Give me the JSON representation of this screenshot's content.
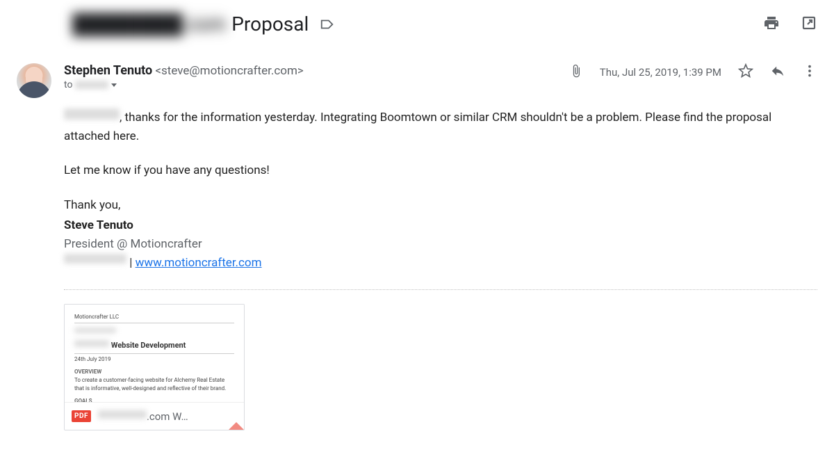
{
  "subject": {
    "redacted_prefix": "████████.com",
    "text": "Proposal"
  },
  "sender": {
    "name": "Stephen Tenuto",
    "email": "<steve@motioncrafter.com>",
    "to_label": "to",
    "to_redacted": "████"
  },
  "meta": {
    "date": "Thu, Jul 25, 2019, 1:39 PM"
  },
  "body": {
    "redacted_name": "████████",
    "p1_rest": ", thanks for the information yesterday. Integrating Boomtown or similar CRM shouldn't be a problem. Please find the proposal attached here.",
    "p2": "Let me know if you have any questions!",
    "p3": "Thank you,"
  },
  "signature": {
    "name": "Steve Tenuto",
    "title": "President @ Motioncrafter",
    "redacted_phone": "███████",
    "separator": " | ",
    "link_text": "www.motioncrafter.com"
  },
  "attachment": {
    "badge": "PDF",
    "filename_redacted": "██████",
    "filename_rest": ".com W…",
    "preview": {
      "company": "Motioncrafter LLC",
      "title_redacted": "██████",
      "title_rest": " Website Development",
      "date": "24th July 2019",
      "overview_label": "OVERVIEW",
      "overview_text": "To create a customer-facing website for Alchemy Real Estate that is informative, well-designed and reflective of their brand.",
      "goals_label": "GOALS"
    }
  }
}
